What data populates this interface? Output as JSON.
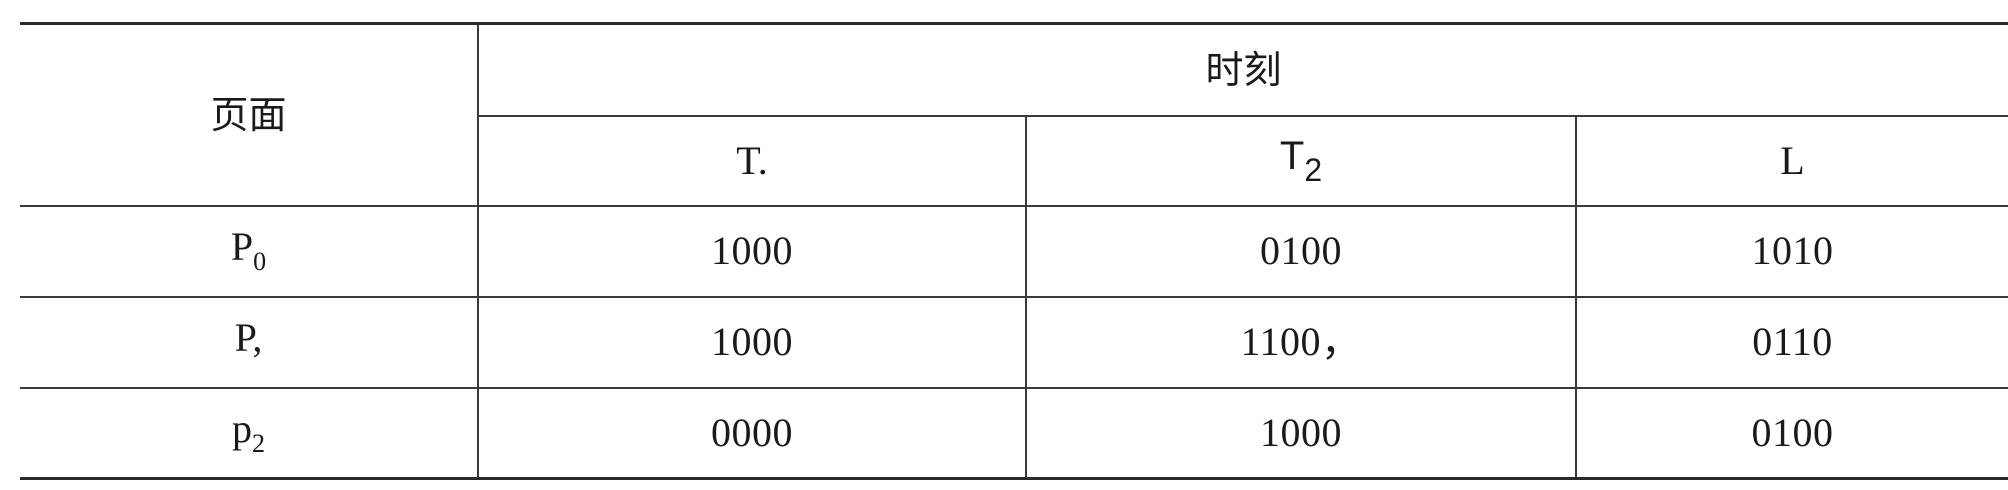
{
  "table": {
    "header": {
      "page_label": "页面",
      "time_label": "时刻",
      "time_columns": [
        {
          "main": "T.",
          "sub": ""
        },
        {
          "main": "T",
          "sub": "2"
        },
        {
          "main": "L",
          "sub": ""
        }
      ]
    },
    "rows": [
      {
        "page_main": "P",
        "page_sub": "0",
        "values": [
          "1000",
          "0100",
          "1010"
        ]
      },
      {
        "page_main": "P,",
        "page_sub": "",
        "values": [
          "1000",
          "1100，",
          "0110"
        ]
      },
      {
        "page_main": "p",
        "page_sub": "2",
        "values": [
          "0000",
          "1000",
          "0100"
        ]
      }
    ]
  }
}
